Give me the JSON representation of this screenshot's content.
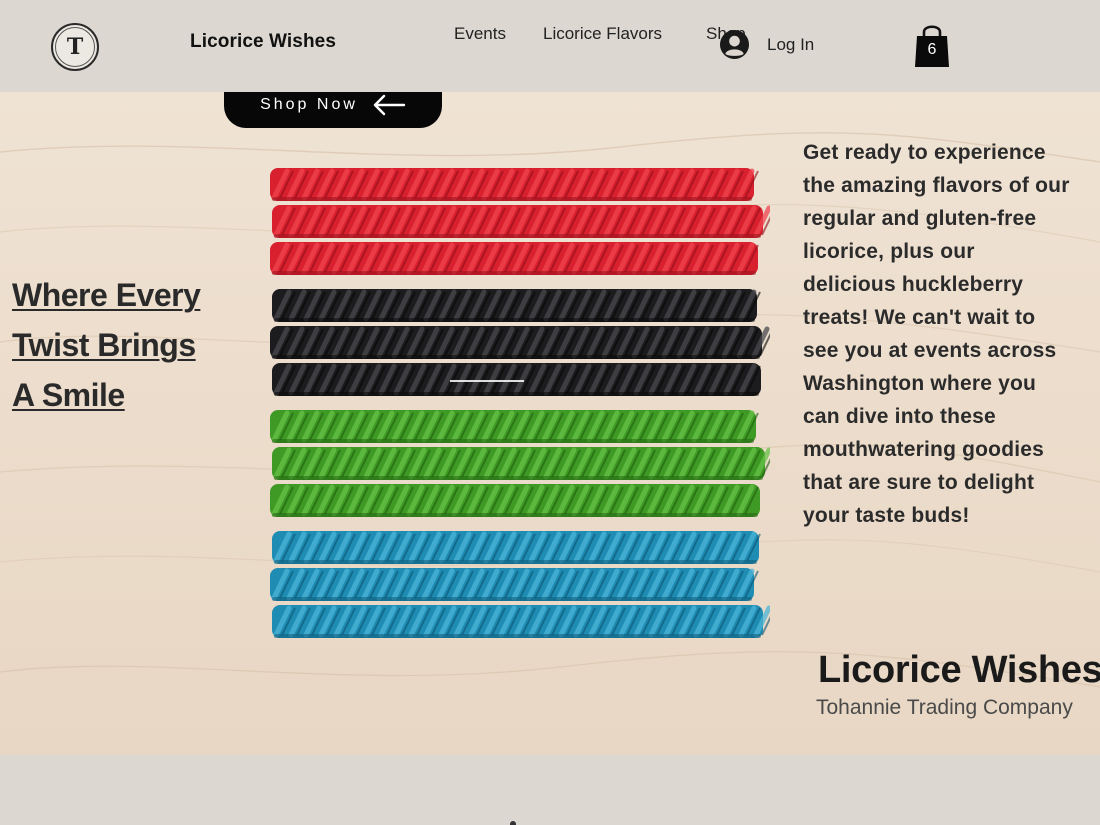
{
  "header": {
    "logo_letter": "T",
    "site_title": "Licorice Wishes",
    "nav": [
      "Events",
      "Licorice Flavors",
      "Shop"
    ],
    "login_label": "Log In",
    "cart_count": "6"
  },
  "hero": {
    "shop_button_label": "Shop Now",
    "headline": [
      "Where Every",
      "Twist Brings",
      "A Smile"
    ],
    "description": "Get ready to experience the amazing flavors of our regular and gluten-free licorice, plus our delicious huckleberry treats! We can't wait to see you at events across Washington where you can dive into these mouthwatering goodies that are sure to delight your taste buds!",
    "brand_title": "Licorice Wishes",
    "brand_subtitle": "Tohannie Trading Company",
    "licorice_rows": [
      {
        "color": "#d8202e",
        "highlight": "#f04450",
        "shadow": "#8e0f19"
      },
      {
        "color": "#d8202e",
        "highlight": "#f04450",
        "shadow": "#8e0f19"
      },
      {
        "color": "#d8202e",
        "highlight": "#f04450",
        "shadow": "#8e0f19"
      },
      {
        "color": "#1c1c1e",
        "highlight": "#4a4a4e",
        "shadow": "#050505"
      },
      {
        "color": "#1c1c1e",
        "highlight": "#4a4a4e",
        "shadow": "#050505"
      },
      {
        "color": "#1c1c1e",
        "highlight": "#4a4a4e",
        "shadow": "#050505"
      },
      {
        "color": "#3e9a24",
        "highlight": "#68c248",
        "shadow": "#1f5e10"
      },
      {
        "color": "#3e9a24",
        "highlight": "#68c248",
        "shadow": "#1f5e10"
      },
      {
        "color": "#3e9a24",
        "highlight": "#68c248",
        "shadow": "#1f5e10"
      },
      {
        "color": "#1f8db3",
        "highlight": "#4cb6d8",
        "shadow": "#0d5472"
      },
      {
        "color": "#1f8db3",
        "highlight": "#4cb6d8",
        "shadow": "#0d5472"
      },
      {
        "color": "#1f8db3",
        "highlight": "#4cb6d8",
        "shadow": "#0d5472"
      }
    ]
  },
  "colors": {
    "header_bg": "#dcd7d0",
    "button_bg": "#070707",
    "text_dark": "#2a2a2a",
    "wood": "#ecdccb"
  },
  "icons": {
    "user": "account-circle-icon",
    "cart": "shopping-bag-icon",
    "arrow": "arrow-left-icon"
  }
}
